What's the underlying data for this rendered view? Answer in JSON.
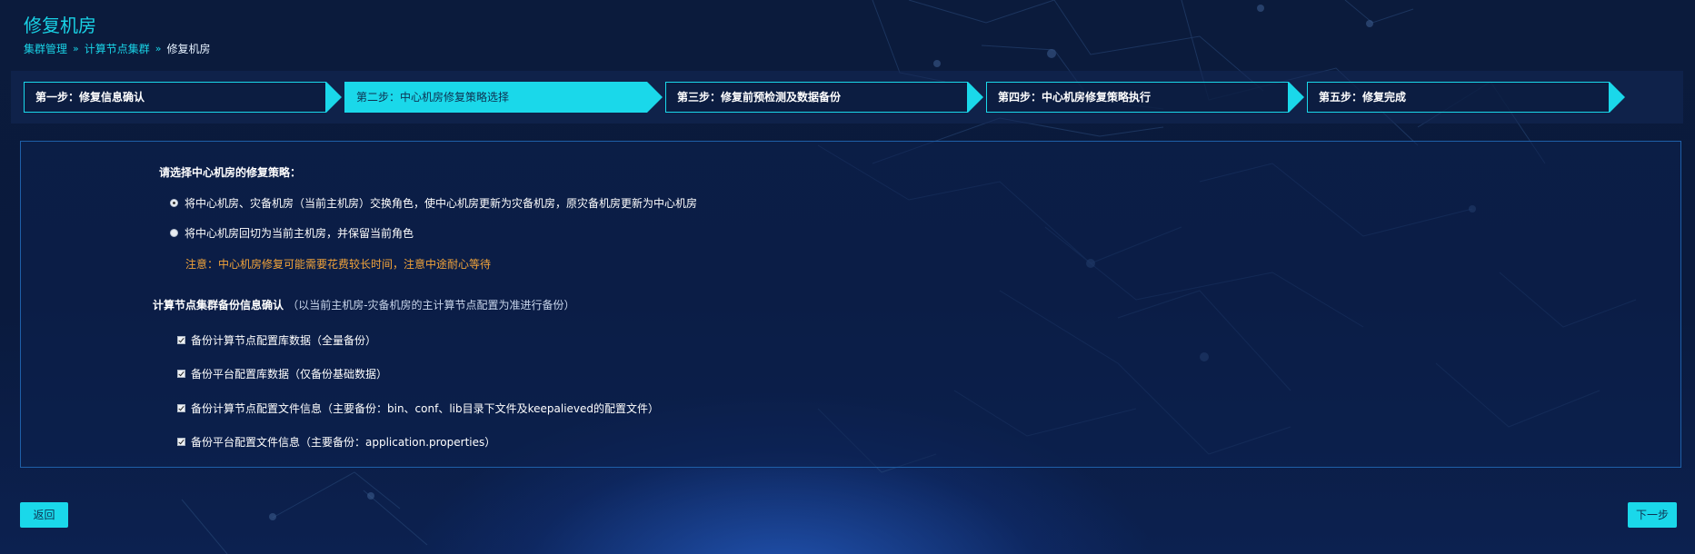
{
  "page": {
    "title": "修复机房",
    "breadcrumb": [
      "集群管理",
      "计算节点集群",
      "修复机房"
    ],
    "breadcrumb_separator": "»"
  },
  "steps": [
    {
      "label": "第一步：修复信息确认",
      "active": false
    },
    {
      "label": "第二步：中心机房修复策略选择",
      "active": true
    },
    {
      "label": "第三步：修复前预检测及数据备份",
      "active": false
    },
    {
      "label": "第四步：中心机房修复策略执行",
      "active": false
    },
    {
      "label": "第五步：修复完成",
      "active": false
    }
  ],
  "strategy": {
    "heading": "请选择中心机房的修复策略：",
    "options": [
      {
        "label": "将中心机房、灾备机房（当前主机房）交换角色，使中心机房更新为灾备机房，原灾备机房更新为中心机房",
        "checked": true
      },
      {
        "label": "将中心机房回切为当前主机房，并保留当前角色",
        "checked": false
      }
    ],
    "warning": "注意：中心机房修复可能需要花费较长时间，注意中途耐心等待"
  },
  "backup": {
    "heading": "计算节点集群备份信息确认",
    "hint": "（以当前主机房-灾备机房的主计算节点配置为准进行备份）",
    "items": [
      {
        "label": "备份计算节点配置库数据（全量备份）",
        "checked": true
      },
      {
        "label": "备份平台配置库数据（仅备份基础数据）",
        "checked": true
      },
      {
        "label": "备份计算节点配置文件信息（主要备份：bin、conf、lib目录下文件及keepalieved的配置文件）",
        "checked": true
      },
      {
        "label": "备份平台配置文件信息（主要备份：application.properties）",
        "checked": true
      }
    ]
  },
  "buttons": {
    "back": "返回",
    "next": "下一步"
  },
  "colors": {
    "accent": "#1ad8ea",
    "warning": "#f2a43a",
    "background": "#0b1b3c"
  }
}
